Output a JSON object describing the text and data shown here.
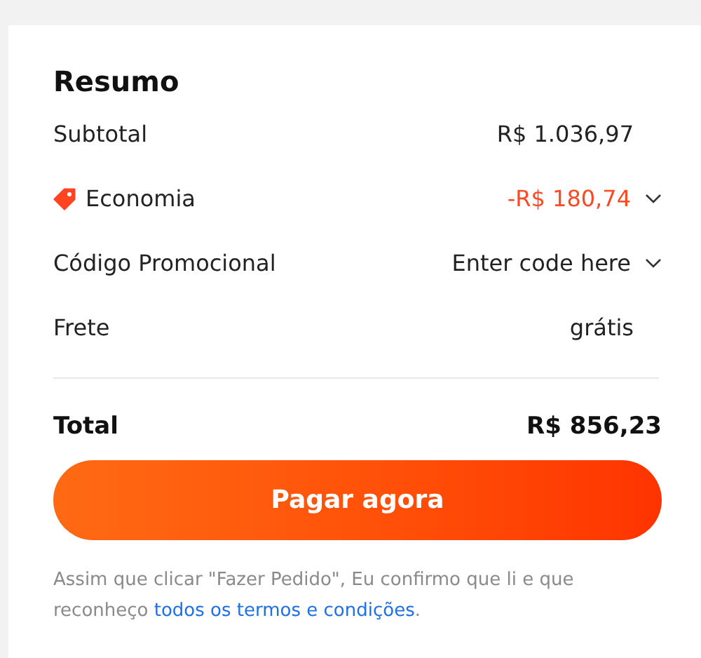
{
  "title": "Resumo",
  "rows": [
    {
      "kind": "amount",
      "label": "Subtotal",
      "value": "R$ 1.036,97"
    },
    {
      "kind": "discount",
      "label": "Economia",
      "value": "-R$ 180,74"
    },
    {
      "kind": "code",
      "label": "Código Promocional",
      "value": "Enter code here"
    },
    {
      "kind": "amount",
      "label": "Frete",
      "value": "grátis"
    }
  ],
  "total": {
    "label": "Total",
    "value": "R$ 856,23"
  },
  "button": "Pagar agora",
  "note": {
    "text": "Assim que clicar \"Fazer Pedido\", Eu confirmo que li e que reconheço ",
    "link": "todos os termos e condições",
    "end": "."
  }
}
